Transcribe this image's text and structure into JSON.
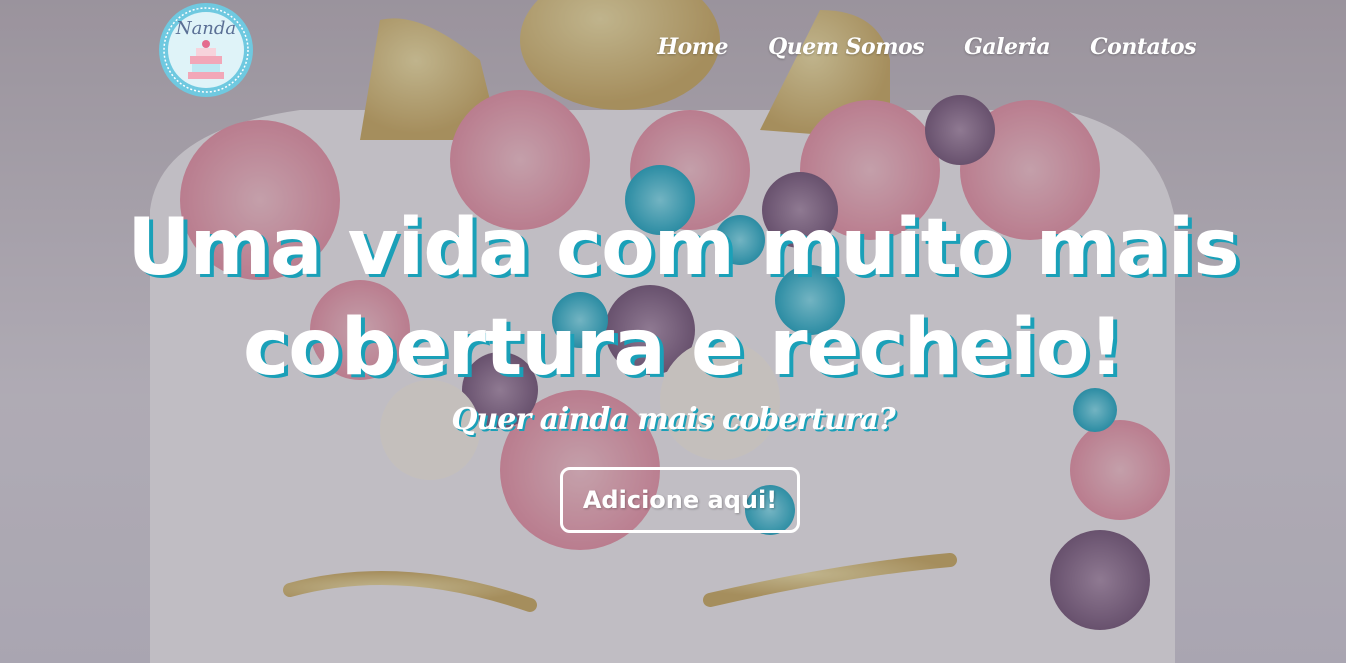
{
  "header": {
    "logo_text": "Nanda",
    "nav": [
      {
        "label": "Home"
      },
      {
        "label": "Quem Somos"
      },
      {
        "label": "Galeria"
      },
      {
        "label": "Contatos"
      }
    ]
  },
  "hero": {
    "headline": "Uma vida com muito mais cobertura e recheio!",
    "subhead": "Quer ainda mais cobertura?",
    "cta_label": "Adicione aqui!",
    "background": "unicorn cake photo",
    "accent_color": "#1aa0b8"
  }
}
